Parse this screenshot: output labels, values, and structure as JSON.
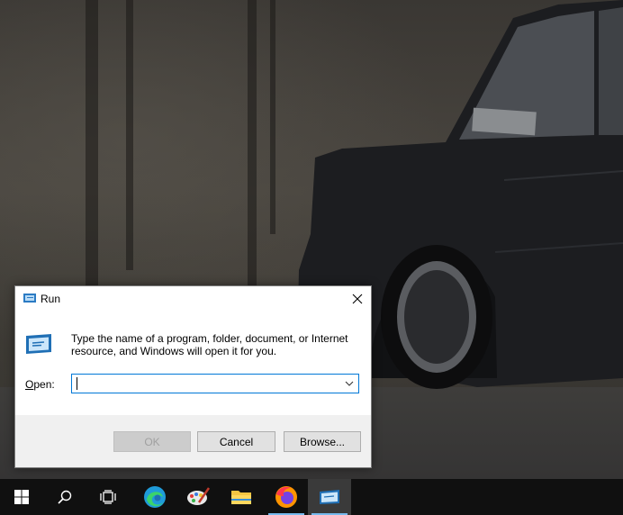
{
  "dialog": {
    "title": "Run",
    "description": "Type the name of a program, folder, document, or Internet resource, and Windows will open it for you.",
    "open_label_prefix": "O",
    "open_label_rest": "pen:",
    "open_value": "",
    "ok_label": "OK",
    "cancel_label": "Cancel",
    "browse_label": "Browse..."
  },
  "taskbar": {
    "items": [
      {
        "name": "start",
        "icon": "windows-logo-icon"
      },
      {
        "name": "search",
        "icon": "search-icon"
      },
      {
        "name": "task-view",
        "icon": "task-view-icon"
      },
      {
        "name": "edge",
        "icon": "edge-icon"
      },
      {
        "name": "paint",
        "icon": "paint-icon"
      },
      {
        "name": "file-explorer",
        "icon": "folder-icon"
      },
      {
        "name": "firefox",
        "icon": "firefox-icon"
      },
      {
        "name": "run",
        "icon": "run-icon",
        "active": true
      }
    ]
  },
  "colors": {
    "accent": "#0078d7",
    "taskbar": "#101010",
    "active_underline": "#76b9ed"
  }
}
